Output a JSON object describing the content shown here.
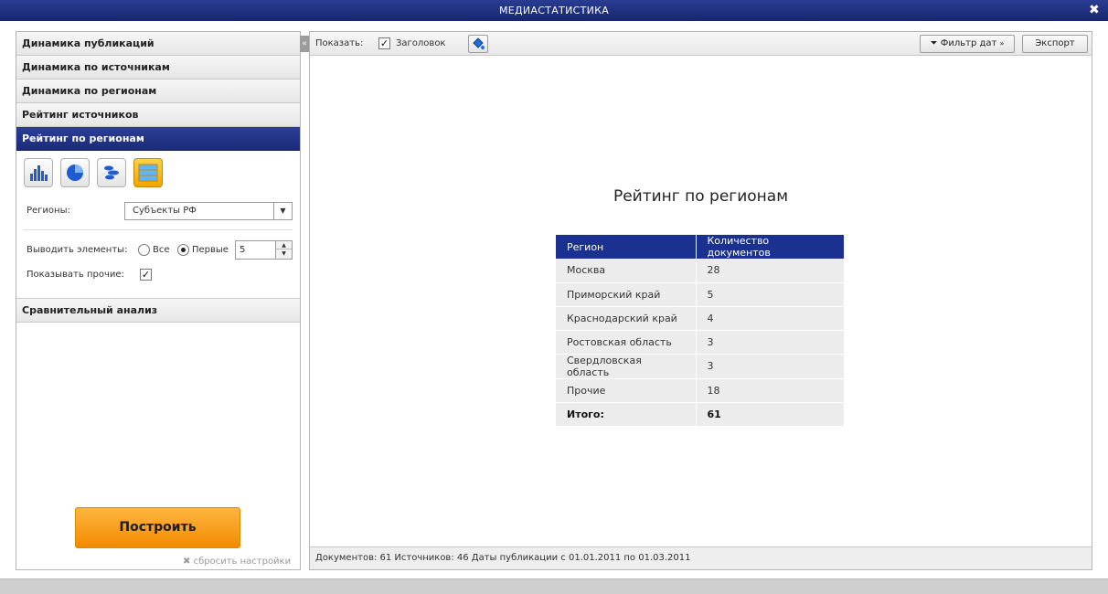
{
  "window": {
    "title": "МЕДИАСТАТИСТИКА",
    "close_glyph": "✖"
  },
  "sidebar": {
    "sections_top": [
      {
        "label": "Динамика публикаций"
      },
      {
        "label": "Динамика по источникам"
      },
      {
        "label": "Динамика по регионам"
      },
      {
        "label": "Рейтинг источников"
      },
      {
        "label": "Рейтинг по регионам",
        "active": true
      }
    ],
    "chart_types": [
      "bar-chart-icon",
      "pie-chart-icon",
      "bubble-chart-icon",
      "table-icon"
    ],
    "selected_chart_type": "table-icon",
    "regions_label": "Регионы:",
    "regions_value": "Субъекты РФ",
    "output_label": "Выводить элементы:",
    "radio_all": "Все",
    "radio_first": "Первые",
    "first_count": "5",
    "show_other_label": "Показывать прочие:",
    "show_other_checked": true,
    "section_bottom": "Сравнительный анализ",
    "build_button": "Построить",
    "reset_link": "сбросить настройки"
  },
  "toolbar": {
    "collapse_glyph": "«",
    "show_label": "Показать:",
    "title_checkbox_label": "Заголовок",
    "title_checked": true,
    "date_filter_button": "Фильтр дат",
    "export_button": "Экспорт"
  },
  "report": {
    "title": "Рейтинг по регионам",
    "columns": [
      "Регион",
      "Количество документов"
    ],
    "rows": [
      {
        "region": "Москва",
        "count": "28"
      },
      {
        "region": "Приморский край",
        "count": "5"
      },
      {
        "region": "Краснодарский край",
        "count": "4"
      },
      {
        "region": "Ростовская область",
        "count": "3"
      },
      {
        "region": "Свердловская область",
        "count": "3"
      },
      {
        "region": "Прочие",
        "count": "18"
      }
    ],
    "total_label": "Итого:",
    "total_value": "61"
  },
  "status": {
    "text": "Документов: 61  Источников: 46  Даты публикации с 01.01.2011 по 01.03.2011"
  },
  "colors": {
    "accent_blue": "#1a318f",
    "build_orange": "#f28a00",
    "header_active": "#2b3f97"
  }
}
